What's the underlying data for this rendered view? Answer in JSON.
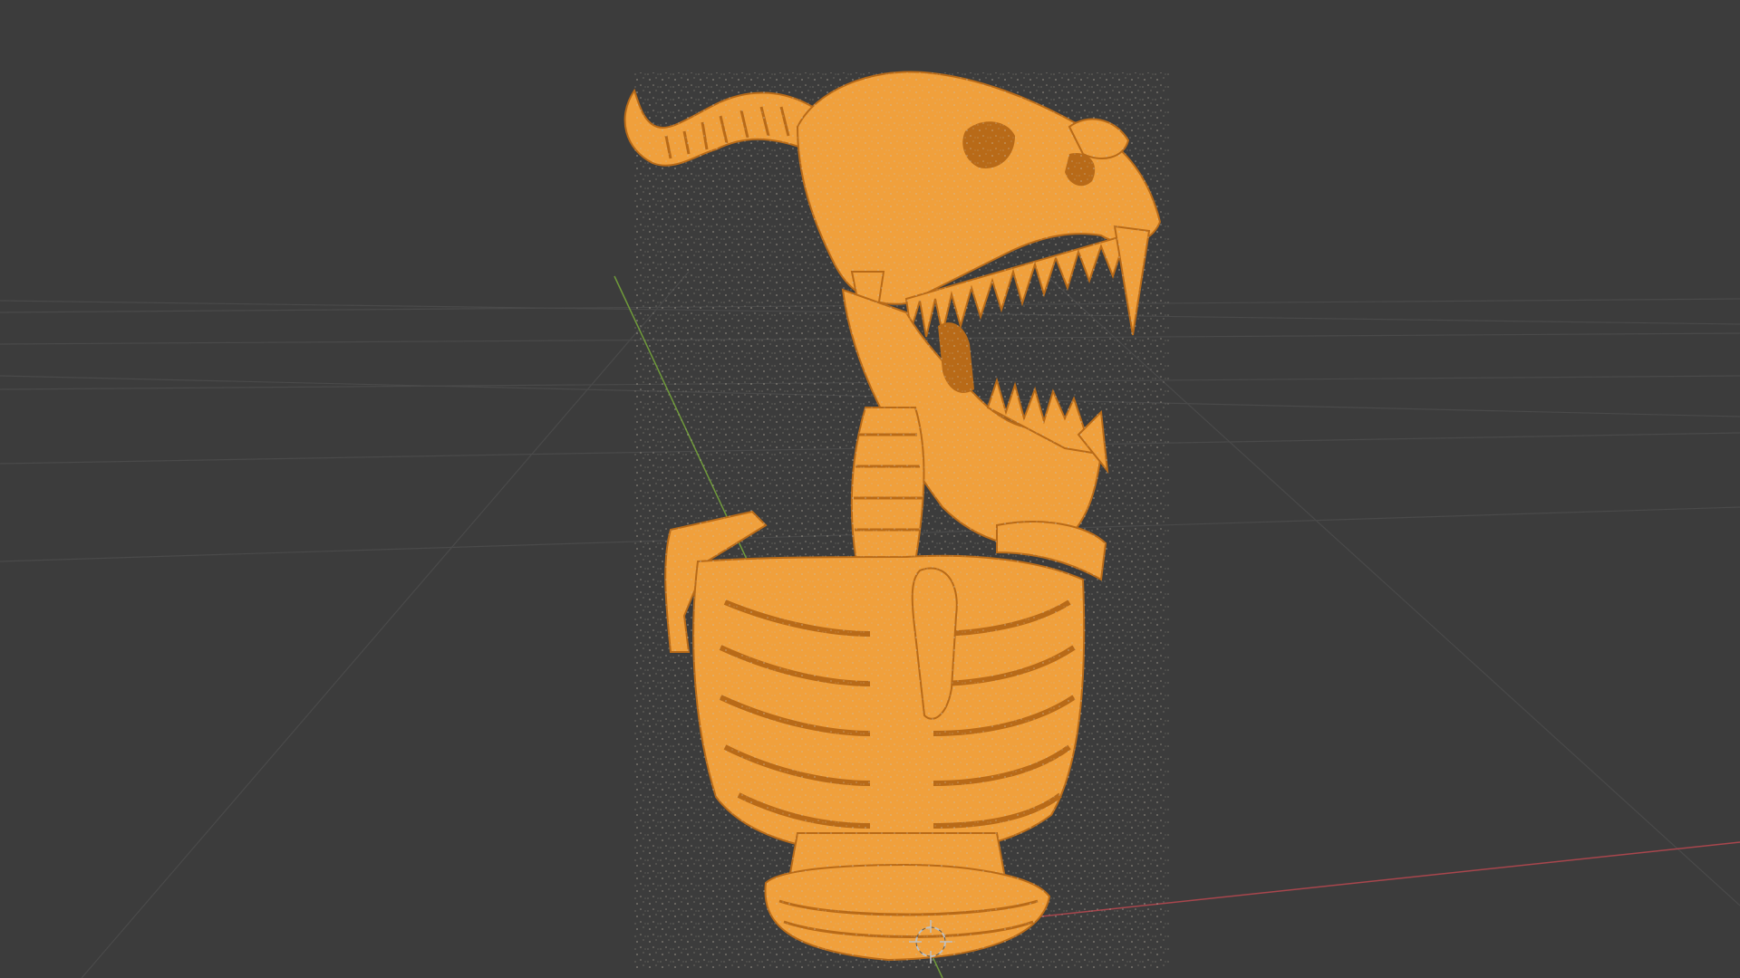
{
  "viewport": {
    "background_color": "#3c3c3c",
    "grid_color": "#4a4a4a",
    "axis_x_color": "#a8464d",
    "axis_y_color": "#6f9a3a",
    "selection_color": "#f0a03c",
    "selection_dark_color": "#b86a18",
    "selection_highlight_color": "#f8c880",
    "mesh_speckle_color": "#c8c0b0",
    "cursor_outer_color": "#c0c0c0",
    "cursor_inner_color": "#5a5a5a"
  },
  "scene": {
    "selected_object_icon": "skeleton-mesh-icon",
    "cursor_icon": "3d-cursor-icon"
  }
}
